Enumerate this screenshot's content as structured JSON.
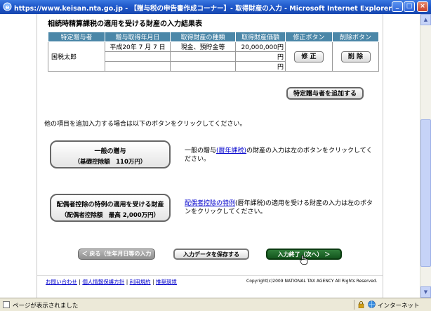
{
  "window": {
    "title": "https://www.keisan.nta.go.jp - 【贈与税の申告書作成コーナー】- 取得財産の入力 - Microsoft Internet Explorer",
    "minimize": "_",
    "maximize": "□",
    "close": "×"
  },
  "page": {
    "heading": "相続時精算課税の適用を受ける財産の入力結果表",
    "table": {
      "headers": [
        "特定贈与者",
        "贈与取得年月日",
        "取得財産の種類",
        "取得財産価額",
        "修正ボタン",
        "削除ボタン"
      ],
      "giver": "国税太郎",
      "rows": [
        {
          "date": "平成20年 7 月 7 日",
          "type": "現金、預貯金等",
          "value": "20,000,000円"
        },
        {
          "date": "",
          "type": "",
          "value": "円"
        },
        {
          "date": "",
          "type": "",
          "value": "円"
        }
      ],
      "edit_button": "修 正",
      "delete_button": "削 除"
    },
    "add_giver_button": "特定贈与者を追加する",
    "info_text": "他の項目を追加入力する場合は以下のボタンをクリックしてください。",
    "general_gift": {
      "line1": "一般の贈与",
      "line2": "（基礎控除額　110万円）",
      "desc_pre": "一般の贈与",
      "desc_link": "(暦年課税)",
      "desc_post": "の財産の入力は左のボタンをクリックしてください。"
    },
    "spouse_gift": {
      "line1": "配偶者控除の特例の適用を受ける財産",
      "line2": "（配偶者控除額　最高 2,000万円）",
      "desc_link": "配偶者控除の特例",
      "desc_post": "(暦年課税)の適用を受ける財産の入力は左のボタンをクリックしてください。"
    },
    "nav": {
      "back": "＜ 戻る（生年月日等の入力へ）",
      "save": "入力データを保存する",
      "finish": "入力終了（次へ） ＞"
    },
    "footer": {
      "links": [
        "お問い合わせ",
        "個人情報保護方針",
        "利用規約",
        "推奨環境"
      ],
      "separator": "|",
      "copyright": "Copyright(c)2009 NATIONAL TAX AGENCY All Rights Reserved."
    }
  },
  "statusbar": {
    "text": "ページが表示されました",
    "zone": "インターネット"
  }
}
